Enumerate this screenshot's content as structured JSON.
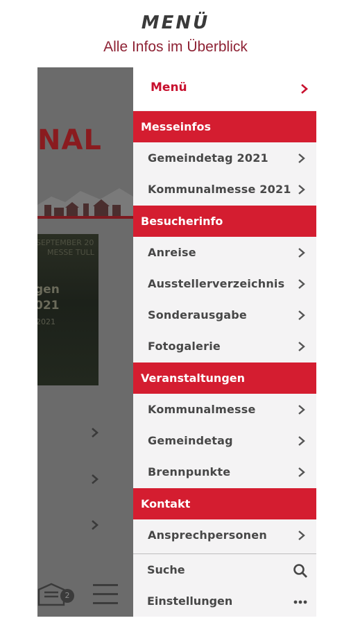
{
  "header": {
    "title": "MENÜ",
    "subtitle": "Alle Infos im Überblick"
  },
  "background_app": {
    "logo_fragment": "NAL",
    "poster_lines": [
      "SEPTEMBER 20",
      "MESSE TULL",
      "gen",
      "021",
      "2021"
    ],
    "mail_badge": "2"
  },
  "drawer": {
    "top": {
      "label": "Menü"
    },
    "sections": [
      {
        "title": "Messeinfos",
        "items": [
          "Gemeindetag 2021",
          "Kommunalmesse 2021"
        ]
      },
      {
        "title": "Besucherinfo",
        "items": [
          "Anreise",
          "Ausstellerverzeichnis",
          "Sonderausgabe",
          "Fotogalerie"
        ]
      },
      {
        "title": "Veranstaltungen",
        "items": [
          "Kommunalmesse",
          "Gemeindetag",
          "Brennpunkte"
        ]
      },
      {
        "title": "Kontakt",
        "items": [
          "Ansprechpersonen"
        ]
      }
    ],
    "footer": {
      "search_label": "Suche",
      "search_icon": "search-icon",
      "settings_label": "Einstellungen",
      "settings_icon": "more-dots-icon"
    }
  },
  "colors": {
    "brand_red": "#d41d30",
    "accent_red": "#c8102e",
    "subtitle": "#8e2234"
  }
}
